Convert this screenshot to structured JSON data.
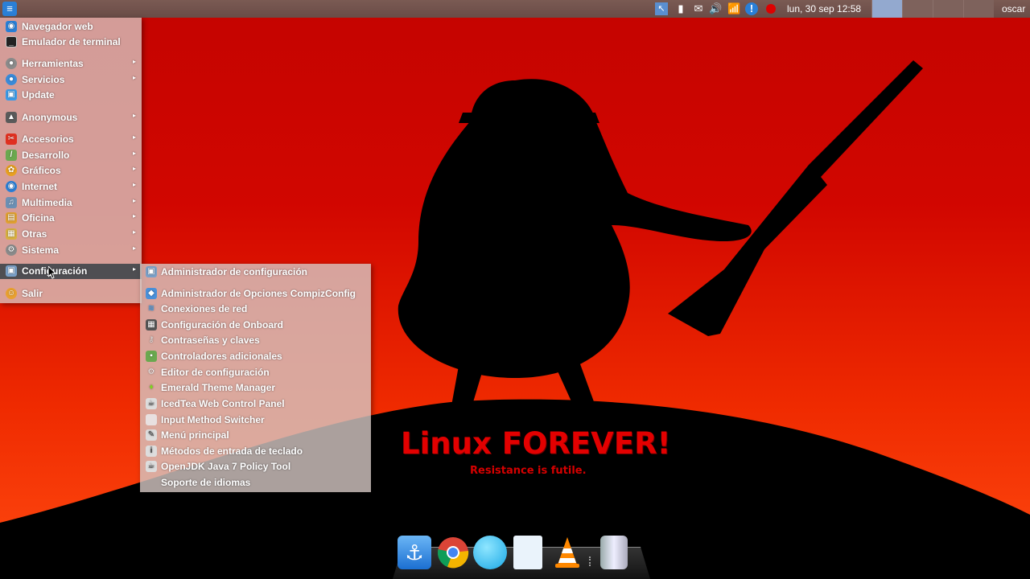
{
  "top_panel": {
    "clock": "lun, 30 sep   12:58",
    "user": "oscar",
    "logo_icon": "xubuntu-menu-icon",
    "tray_icons": [
      "cursor-icon",
      "battery-icon",
      "mail-icon",
      "volume-icon",
      "wifi-icon",
      "info-icon",
      "record-icon"
    ]
  },
  "main_menu": {
    "items": [
      {
        "label": "Navegador web",
        "icon": "globe-icon",
        "submenu": false
      },
      {
        "label": "Emulador de terminal",
        "icon": "terminal-icon",
        "submenu": false
      },
      {
        "label": "Herramientas",
        "icon": "tools-icon",
        "submenu": true
      },
      {
        "label": "Servicios",
        "icon": "services-icon",
        "submenu": true
      },
      {
        "label": "Update",
        "icon": "update-icon",
        "submenu": false
      },
      {
        "label": "Anonymous",
        "icon": "anonymous-icon",
        "submenu": true
      },
      {
        "label": "Accesorios",
        "icon": "accessories-icon",
        "submenu": true
      },
      {
        "label": "Desarrollo",
        "icon": "development-icon",
        "submenu": true
      },
      {
        "label": "Gráficos",
        "icon": "graphics-icon",
        "submenu": true
      },
      {
        "label": "Internet",
        "icon": "internet-icon",
        "submenu": true
      },
      {
        "label": "Multimedia",
        "icon": "multimedia-icon",
        "submenu": true
      },
      {
        "label": "Oficina",
        "icon": "office-icon",
        "submenu": true
      },
      {
        "label": "Otras",
        "icon": "other-icon",
        "submenu": true
      },
      {
        "label": "Sistema",
        "icon": "system-icon",
        "submenu": true
      },
      {
        "label": "Configuración",
        "icon": "settings-icon",
        "submenu": true,
        "active": true
      },
      {
        "label": "Salir",
        "icon": "logout-icon",
        "submenu": false
      }
    ]
  },
  "sub_menu": {
    "items": [
      {
        "label": "Administrador de configuración",
        "icon": "settings-manager-icon"
      },
      {
        "label": "Administrador de Opciones CompizConfig",
        "icon": "compiz-icon"
      },
      {
        "label": "Conexiones de red",
        "icon": "network-icon"
      },
      {
        "label": "Configuración de Onboard",
        "icon": "keyboard-icon"
      },
      {
        "label": "Contraseñas y claves",
        "icon": "key-icon"
      },
      {
        "label": "Controladores adicionales",
        "icon": "drivers-icon"
      },
      {
        "label": "Editor de configuración",
        "icon": "gear-icon"
      },
      {
        "label": "Emerald Theme Manager",
        "icon": "emerald-icon"
      },
      {
        "label": "IcedTea Web Control Panel",
        "icon": "java-icon"
      },
      {
        "label": "Input Method Switcher",
        "icon": "input-method-icon"
      },
      {
        "label": "Menú principal",
        "icon": "menu-editor-icon"
      },
      {
        "label": "Métodos de entrada de teclado",
        "icon": "keyboard-input-icon"
      },
      {
        "label": "OpenJDK Java 7 Policy Tool",
        "icon": "java-policy-icon"
      },
      {
        "label": "Soporte de idiomas",
        "icon": "language-icon"
      }
    ]
  },
  "wallpaper": {
    "title": "Linux FOREVER!",
    "subtitle": "Resistance is futile."
  },
  "dock": {
    "icons": [
      "anchor-icon",
      "chrome-icon",
      "blue-orb-icon",
      "document-viewer-icon",
      "vlc-icon",
      "trash-icon"
    ]
  },
  "colors": {
    "panel": "#6e4f49",
    "menu_bg": "#d7c8c3",
    "active_item": "#4f4e52",
    "wallpaper_red": "#d10600"
  }
}
